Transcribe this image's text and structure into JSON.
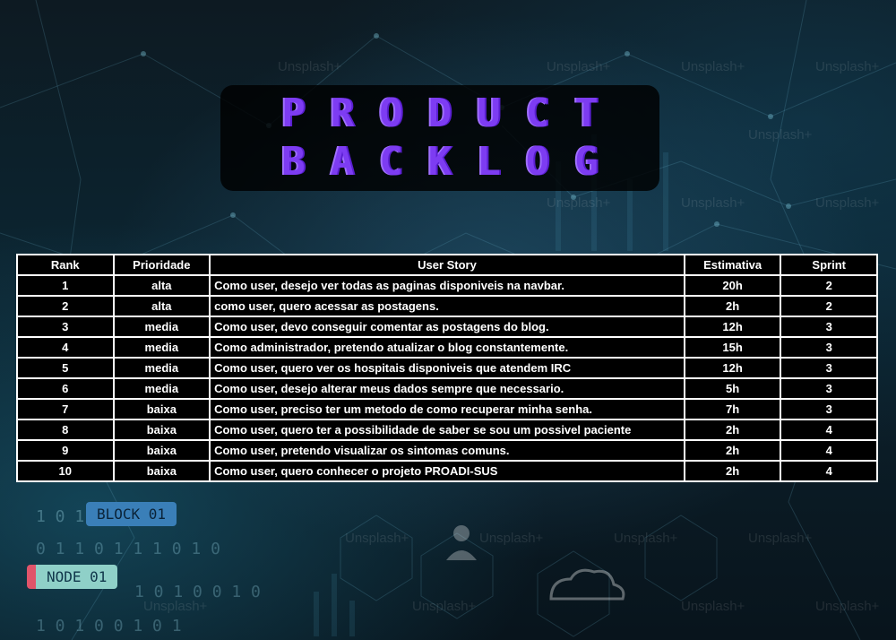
{
  "title": {
    "line1": "PRODUCT",
    "line2": "BACKLOG"
  },
  "background": {
    "watermark_text": "Unsplash+",
    "badge_block": "BLOCK 01",
    "badge_node": "NODE 01",
    "binary_rows": [
      "1 0 1 0 0 1 0",
      "0 1 1 0 1 1 1 0 1 0",
      "1 0 1 0 0 1 0",
      "1 0 1 0 0 1 0 1"
    ]
  },
  "table": {
    "headers": {
      "rank": "Rank",
      "priority": "Prioridade",
      "story": "User Story",
      "estimate": "Estimativa",
      "sprint": "Sprint"
    },
    "rows": [
      {
        "rank": "1",
        "priority": "alta",
        "story": "Como user, desejo ver todas as paginas disponiveis na navbar.",
        "estimate": "20h",
        "sprint": "2"
      },
      {
        "rank": "2",
        "priority": "alta",
        "story": "como user, quero acessar as postagens.",
        "estimate": "2h",
        "sprint": "2"
      },
      {
        "rank": "3",
        "priority": "media",
        "story": "Como user, devo conseguir comentar as postagens do blog.",
        "estimate": "12h",
        "sprint": "3"
      },
      {
        "rank": "4",
        "priority": "media",
        "story": "Como administrador, pretendo atualizar o blog constantemente.",
        "estimate": "15h",
        "sprint": "3"
      },
      {
        "rank": "5",
        "priority": "media",
        "story": "Como user, quero ver os hospitais disponiveis que atendem IRC",
        "estimate": "12h",
        "sprint": "3"
      },
      {
        "rank": "6",
        "priority": "media",
        "story": "Como user, desejo alterar meus dados sempre que necessario.",
        "estimate": "5h",
        "sprint": "3"
      },
      {
        "rank": "7",
        "priority": "baixa",
        "story": "Como user, preciso ter um metodo de como recuperar minha senha.",
        "estimate": "7h",
        "sprint": "3"
      },
      {
        "rank": "8",
        "priority": "baixa",
        "story": "Como user, quero ter a possibilidade de saber se sou um possivel paciente",
        "estimate": "2h",
        "sprint": "4"
      },
      {
        "rank": "9",
        "priority": "baixa",
        "story": "Como user, pretendo visualizar os sintomas comuns.",
        "estimate": "2h",
        "sprint": "4"
      },
      {
        "rank": "10",
        "priority": "baixa",
        "story": "Como user, quero conhecer o projeto PROADI-SUS",
        "estimate": "2h",
        "sprint": "4"
      }
    ]
  }
}
